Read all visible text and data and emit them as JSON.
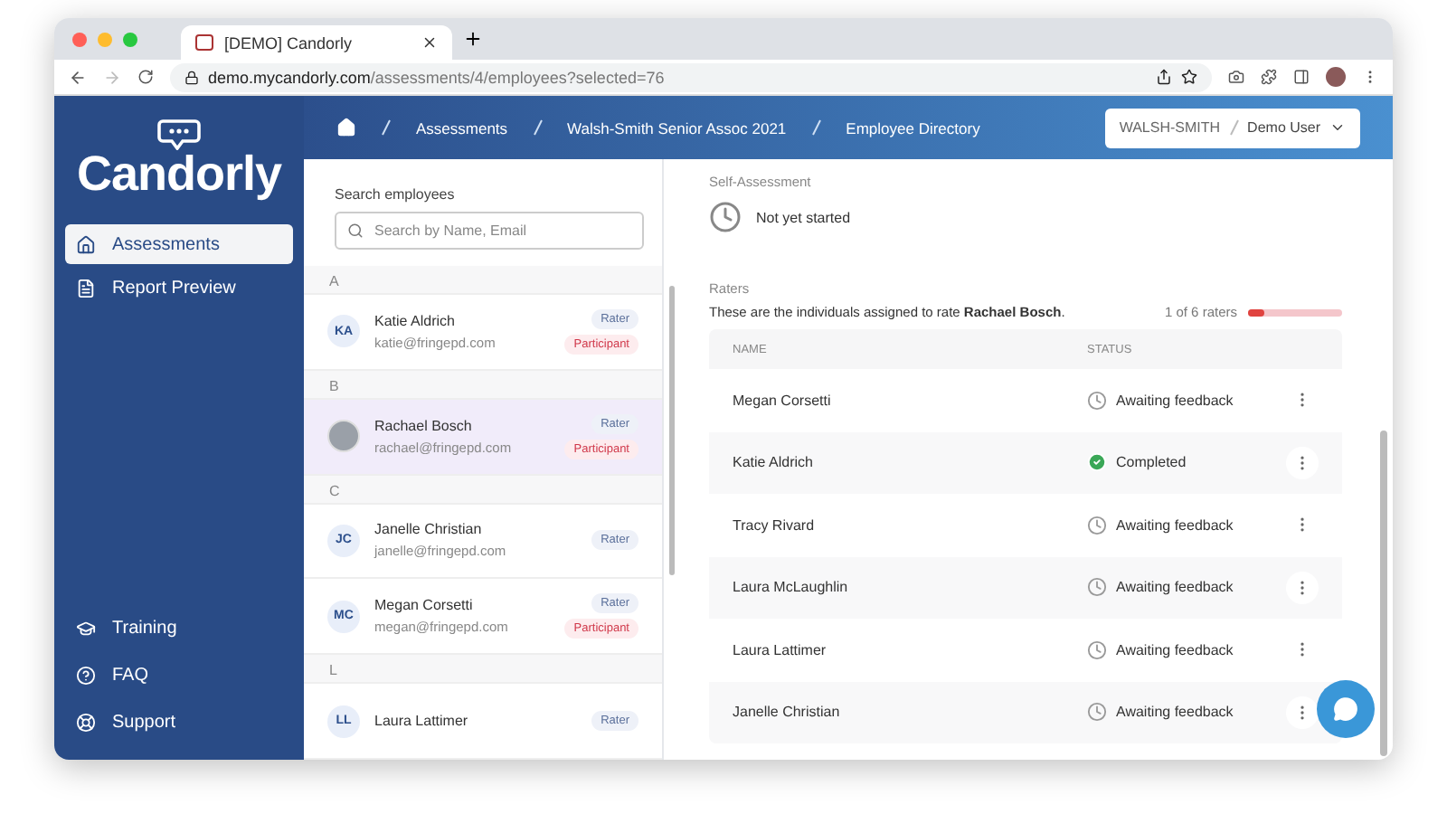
{
  "browser": {
    "tab_title": "[DEMO] Candorly",
    "url_host": "demo.mycandorly.com",
    "url_path": "/assessments/4/employees?selected=76"
  },
  "sidebar": {
    "logo": "Candorly",
    "items": [
      {
        "label": "Assessments",
        "selected": true
      },
      {
        "label": "Report Preview",
        "selected": false
      }
    ],
    "footer_items": [
      "Training",
      "FAQ",
      "Support"
    ]
  },
  "header": {
    "breadcrumbs": [
      "Assessments",
      "Walsh-Smith Senior Assoc 2021",
      "Employee Directory"
    ],
    "org": "WALSH-SMITH",
    "user": "Demo User"
  },
  "employees": {
    "search_label": "Search employees",
    "search": {
      "placeholder": "Search by Name, Email"
    },
    "groups": [
      {
        "letter": "A",
        "people": [
          {
            "initials": "KA",
            "name": "Katie Aldrich",
            "email": "katie@fringepd.com",
            "selected": false,
            "badges": [
              {
                "label": "Rater",
                "kind": "rater"
              },
              {
                "label": "Participant",
                "kind": "participant"
              }
            ]
          }
        ]
      },
      {
        "letter": "B",
        "people": [
          {
            "name": "Rachael Bosch",
            "email": "rachael@fringepd.com",
            "selected": true,
            "badges": [
              {
                "label": "Rater",
                "kind": "rater"
              },
              {
                "label": "Participant",
                "kind": "participant"
              }
            ]
          }
        ]
      },
      {
        "letter": "C",
        "people": [
          {
            "initials": "JC",
            "name": "Janelle Christian",
            "email": "janelle@fringepd.com",
            "selected": false,
            "badges": [
              {
                "label": "Rater",
                "kind": "rater"
              }
            ]
          },
          {
            "initials": "MC",
            "name": "Megan Corsetti",
            "email": "megan@fringepd.com",
            "selected": false,
            "badges": [
              {
                "label": "Rater",
                "kind": "rater"
              },
              {
                "label": "Participant",
                "kind": "participant"
              }
            ]
          }
        ]
      },
      {
        "letter": "L",
        "people": [
          {
            "initials": "LL",
            "name": "Laura Lattimer",
            "selected": false,
            "badges": [
              {
                "label": "Rater",
                "kind": "rater"
              }
            ]
          }
        ]
      }
    ]
  },
  "detail": {
    "self_assessment": {
      "label": "Self-Assessment",
      "status": "Not yet started"
    },
    "raters": {
      "label": "Raters",
      "intro": "These are the individuals assigned to rate **Rachael Bosch**.",
      "progress_text": "1 of 6 raters",
      "level": 0.17,
      "columns": [
        "NAME",
        "STATUS"
      ],
      "rows": [
        {
          "name": "Megan Corsetti",
          "kind": "awaiting",
          "status": "Awaiting feedback"
        },
        {
          "name": "Katie Aldrich",
          "kind": "completed",
          "status": "Completed"
        },
        {
          "name": "Tracy Rivard",
          "kind": "awaiting",
          "status": "Awaiting feedback"
        },
        {
          "name": "Laura McLaughlin",
          "kind": "awaiting",
          "status": "Awaiting feedback"
        },
        {
          "name": "Laura Lattimer",
          "kind": "awaiting",
          "status": "Awaiting feedback"
        },
        {
          "name": "Janelle Christian",
          "kind": "awaiting",
          "status": "Awaiting feedback"
        }
      ]
    }
  }
}
